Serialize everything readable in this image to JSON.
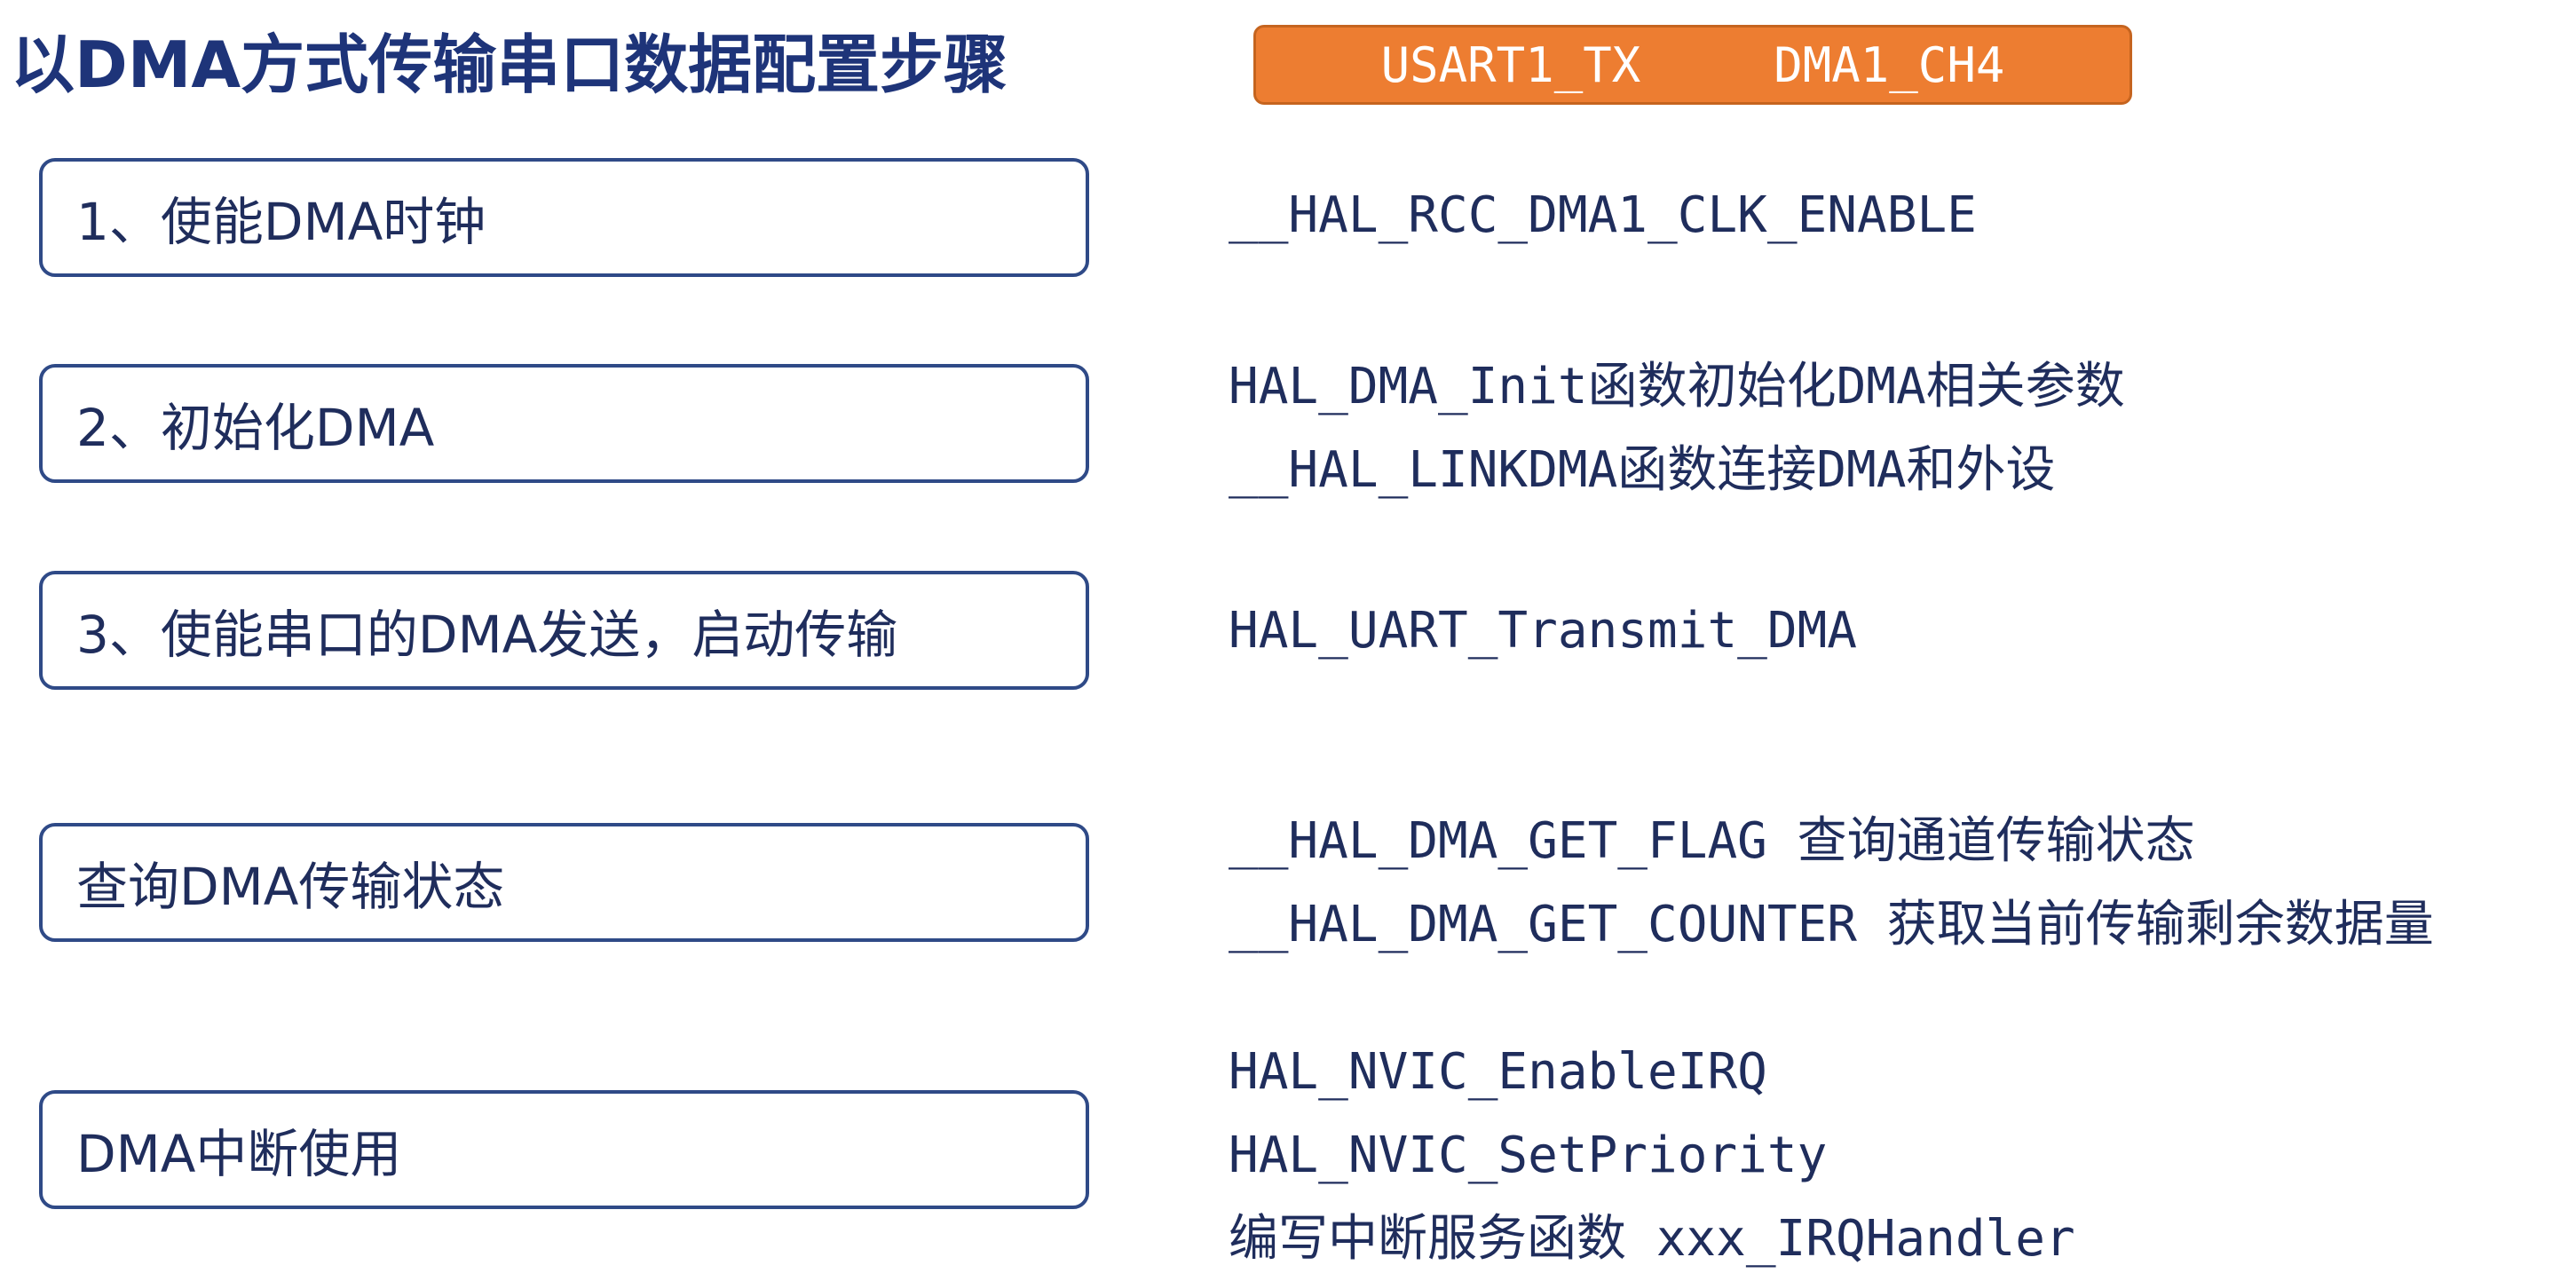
{
  "page_title": "以DMA方式传输串口数据配置步骤",
  "mapping_badge": {
    "tx_label": "USART1_TX",
    "channel_label": "DMA1_CH4"
  },
  "steps": [
    {
      "label": "1、使能DMA时钟",
      "details": [
        "__HAL_RCC_DMA1_CLK_ENABLE"
      ]
    },
    {
      "label": "2、初始化DMA",
      "details": [
        "HAL_DMA_Init函数初始化DMA相关参数",
        "__HAL_LINKDMA函数连接DMA和外设"
      ]
    },
    {
      "label": "3、使能串口的DMA发送，启动传输",
      "details": [
        "HAL_UART_Transmit_DMA"
      ]
    },
    {
      "label": "查询DMA传输状态",
      "details": [
        "__HAL_DMA_GET_FLAG 查询通道传输状态",
        "__HAL_DMA_GET_COUNTER 获取当前传输剩余数据量"
      ]
    },
    {
      "label": "DMA中断使用",
      "details": [
        "HAL_NVIC_EnableIRQ",
        "HAL_NVIC_SetPriority",
        "编写中断服务函数 xxx_IRQHandler"
      ]
    }
  ]
}
